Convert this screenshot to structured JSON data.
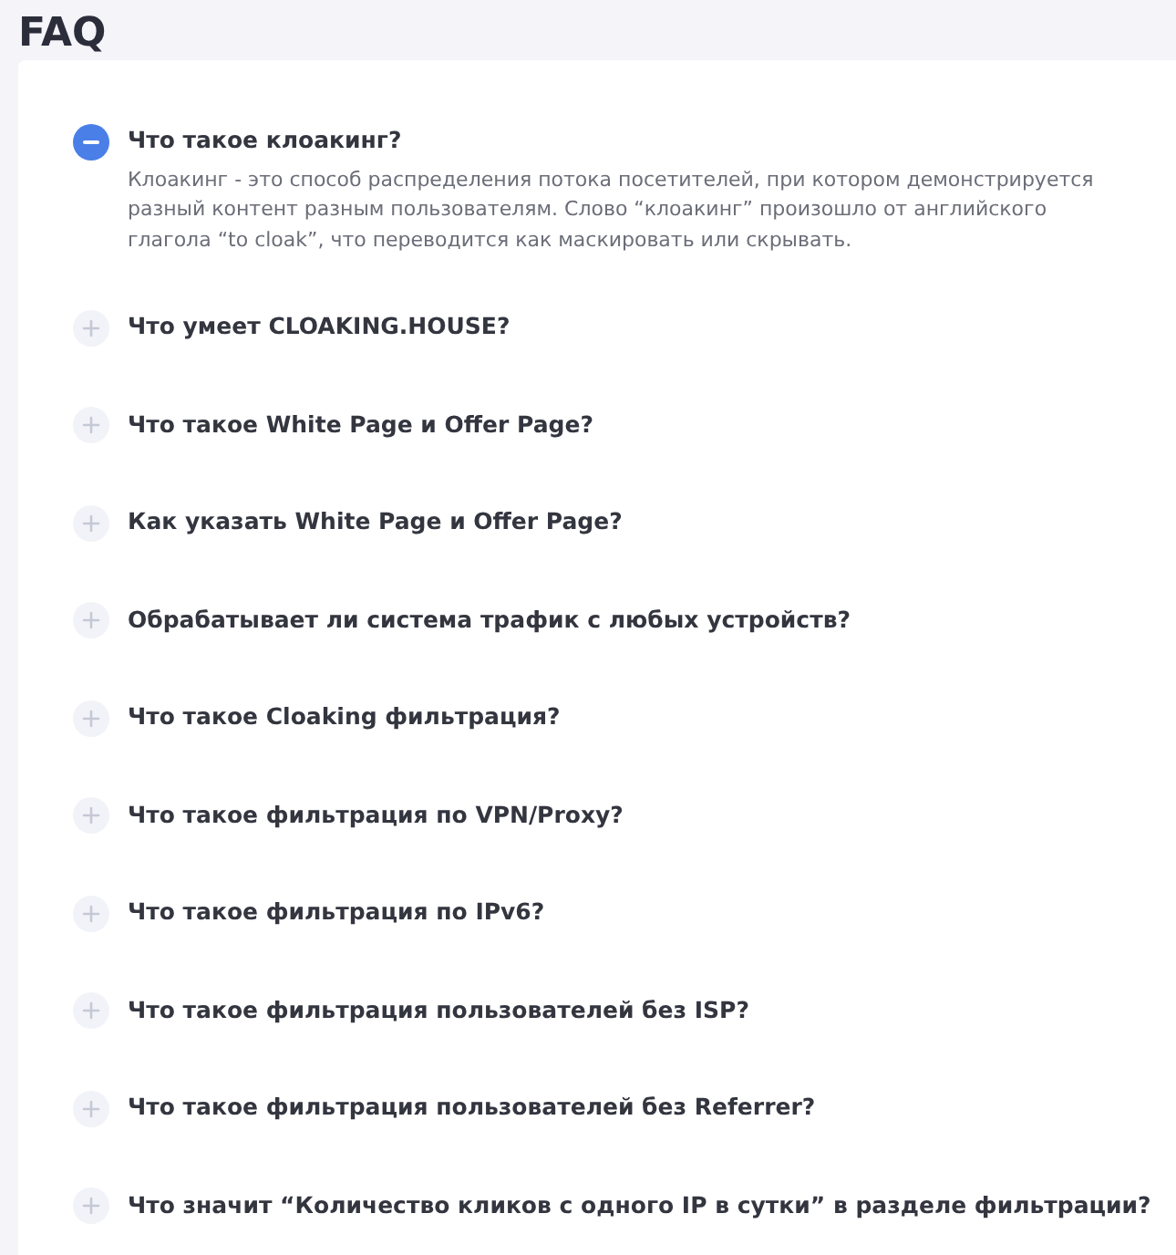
{
  "title": "FAQ",
  "items": [
    {
      "question": "Что такое клоакинг?",
      "expanded": true,
      "answer": "Клоакинг - это способ распределения потока посетителей, при котором демонстрируется разный контент разным пользователям. Слово “клоакинг” произошло от английского глагола “to cloak”, что переводится как маскировать или скрывать."
    },
    {
      "question": "Что умеет CLOAKING.HOUSE?",
      "expanded": false
    },
    {
      "question": "Что такое White Page и Offer Page?",
      "expanded": false
    },
    {
      "question": "Как указать White Page и Offer Page?",
      "expanded": false
    },
    {
      "question": "Обрабатывает ли система трафик с любых устройств?",
      "expanded": false
    },
    {
      "question": "Что такое Cloaking фильтрация?",
      "expanded": false
    },
    {
      "question": "Что такое фильтрация по VPN/Proxy?",
      "expanded": false
    },
    {
      "question": "Что такое фильтрация по IPv6?",
      "expanded": false
    },
    {
      "question": "Что такое фильтрация пользователей без ISP?",
      "expanded": false
    },
    {
      "question": "Что такое фильтрация пользователей без Referrer?",
      "expanded": false
    },
    {
      "question": "Что значит “Количество кликов с одного IP в сутки” в разделе фильтрации?",
      "expanded": false
    }
  ]
}
